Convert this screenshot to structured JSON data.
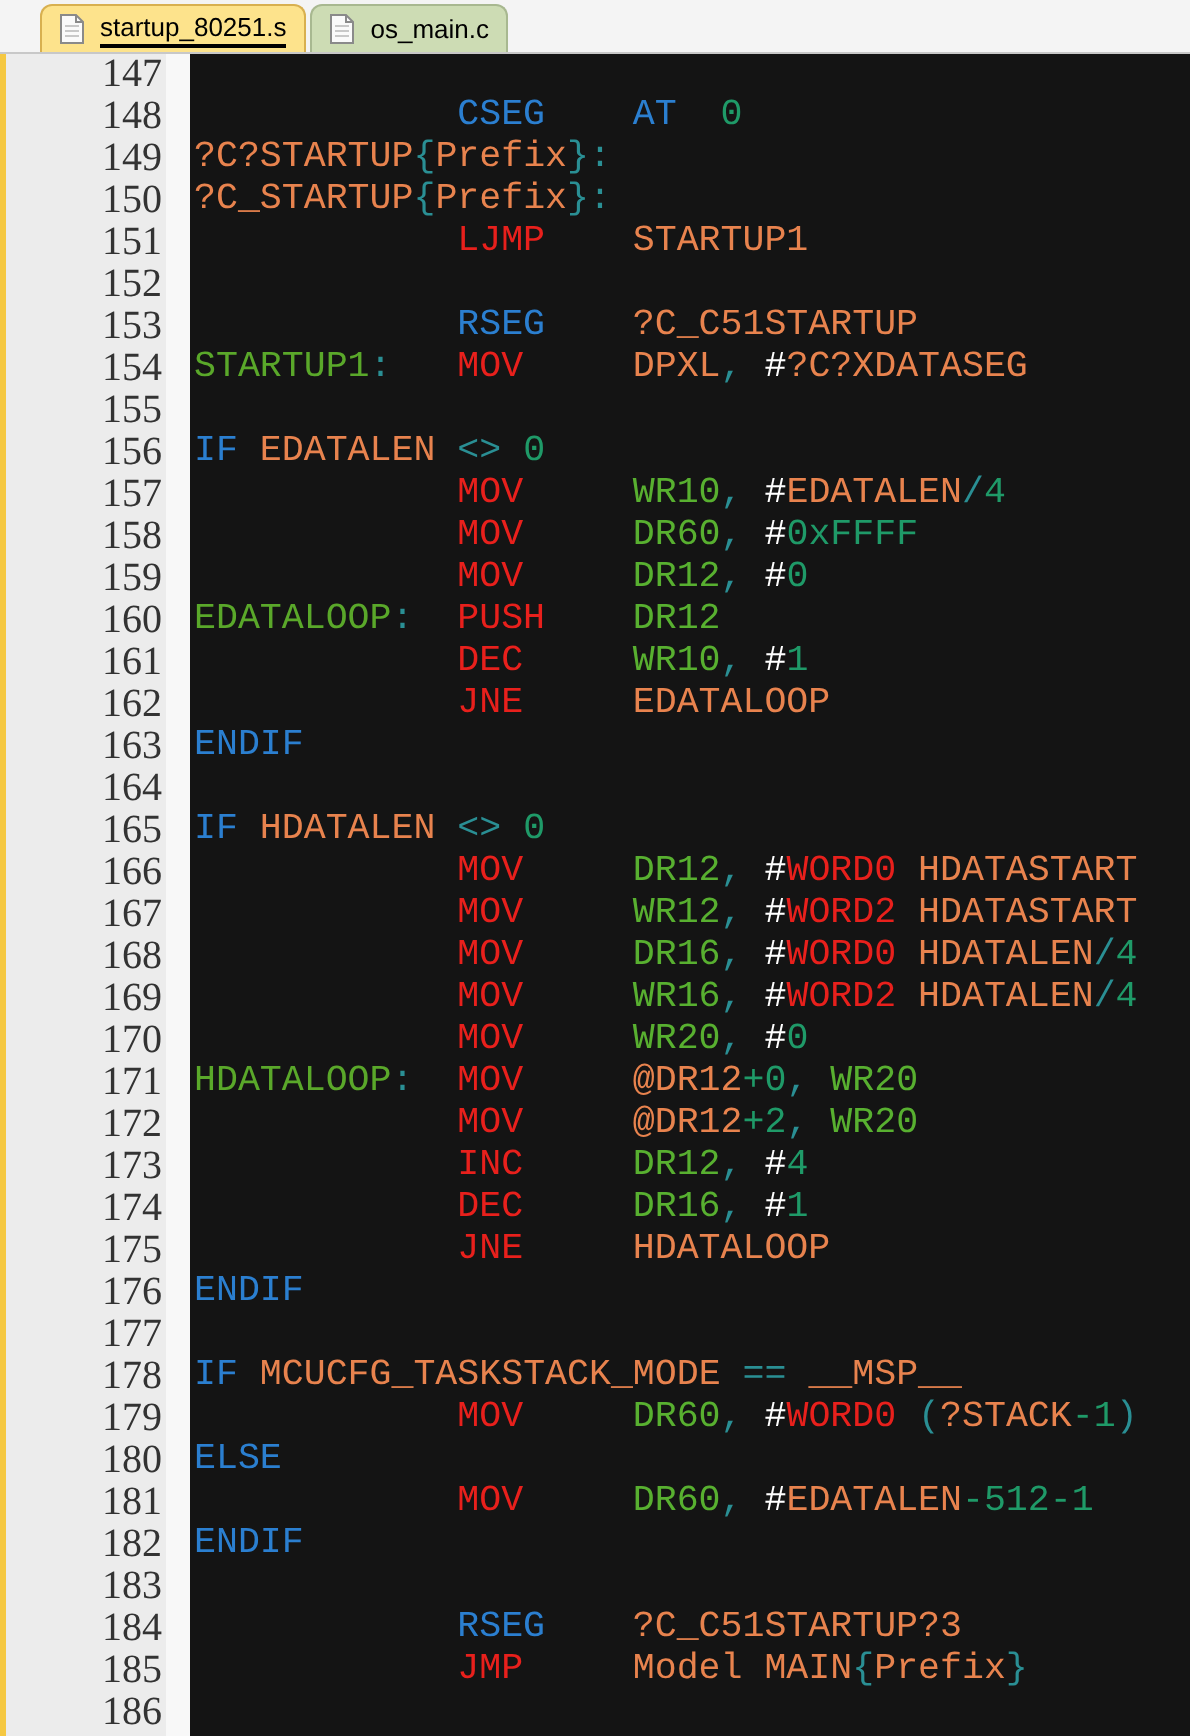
{
  "tabs": [
    {
      "label": "startup_80251.s",
      "selected": true
    },
    {
      "label": "os_main.c",
      "selected": false
    }
  ],
  "lines": [
    {
      "number": "147"
    },
    {
      "number": "148",
      "op": {
        "text": "CSEG",
        "kind": "kw"
      },
      "args": [
        {
          "text": "AT  ",
          "kind": "kw"
        },
        {
          "text": "0",
          "kind": "num"
        }
      ]
    },
    {
      "number": "149",
      "label": [
        {
          "text": "?C?STARTUP",
          "kind": "id"
        },
        {
          "text": "{",
          "kind": "p"
        },
        {
          "text": "Prefix",
          "kind": "id"
        },
        {
          "text": "}",
          "kind": "p"
        },
        {
          "text": ":",
          "kind": "p"
        }
      ]
    },
    {
      "number": "150",
      "label": [
        {
          "text": "?C_STARTUP",
          "kind": "id"
        },
        {
          "text": "{",
          "kind": "p"
        },
        {
          "text": "Prefix",
          "kind": "id"
        },
        {
          "text": "}",
          "kind": "p"
        },
        {
          "text": ":",
          "kind": "p"
        }
      ]
    },
    {
      "number": "151",
      "op": {
        "text": "LJMP",
        "kind": "mn"
      },
      "args": [
        {
          "text": "STARTUP1",
          "kind": "id"
        }
      ]
    },
    {
      "number": "152"
    },
    {
      "number": "153",
      "op": {
        "text": "RSEG",
        "kind": "kw"
      },
      "args": [
        {
          "text": "?C_C51STARTUP",
          "kind": "id"
        }
      ]
    },
    {
      "number": "154",
      "label": [
        {
          "text": "STARTUP1",
          "kind": "lbl"
        },
        {
          "text": ":",
          "kind": "p"
        }
      ],
      "op": {
        "text": "MOV",
        "kind": "mn"
      },
      "args": [
        {
          "text": "DPXL",
          "kind": "id"
        },
        {
          "text": ", ",
          "kind": "p"
        },
        {
          "text": "#",
          "kind": "hash"
        },
        {
          "text": "?C?XDATASEG",
          "kind": "id"
        }
      ]
    },
    {
      "number": "155"
    },
    {
      "number": "156",
      "label": [
        {
          "text": "IF ",
          "kind": "kw"
        },
        {
          "text": "EDATALEN ",
          "kind": "id"
        },
        {
          "text": "<> ",
          "kind": "p"
        },
        {
          "text": "0",
          "kind": "num"
        }
      ]
    },
    {
      "number": "157",
      "op": {
        "text": "MOV",
        "kind": "mn"
      },
      "args": [
        {
          "text": "WR10",
          "kind": "reg"
        },
        {
          "text": ", ",
          "kind": "p"
        },
        {
          "text": "#",
          "kind": "hash"
        },
        {
          "text": "EDATALEN",
          "kind": "id"
        },
        {
          "text": "/",
          "kind": "p"
        },
        {
          "text": "4",
          "kind": "num"
        }
      ]
    },
    {
      "number": "158",
      "op": {
        "text": "MOV",
        "kind": "mn"
      },
      "args": [
        {
          "text": "DR60",
          "kind": "reg"
        },
        {
          "text": ", ",
          "kind": "p"
        },
        {
          "text": "#",
          "kind": "hash"
        },
        {
          "text": "0xFFFF",
          "kind": "num"
        }
      ]
    },
    {
      "number": "159",
      "op": {
        "text": "MOV",
        "kind": "mn"
      },
      "args": [
        {
          "text": "DR12",
          "kind": "reg"
        },
        {
          "text": ", ",
          "kind": "p"
        },
        {
          "text": "#",
          "kind": "hash"
        },
        {
          "text": "0",
          "kind": "num"
        }
      ]
    },
    {
      "number": "160",
      "label": [
        {
          "text": "EDATALOOP",
          "kind": "lbl"
        },
        {
          "text": ":",
          "kind": "p"
        }
      ],
      "op": {
        "text": "PUSH",
        "kind": "mn"
      },
      "args": [
        {
          "text": "DR12",
          "kind": "reg"
        }
      ]
    },
    {
      "number": "161",
      "op": {
        "text": "DEC",
        "kind": "mn"
      },
      "args": [
        {
          "text": "WR10",
          "kind": "reg"
        },
        {
          "text": ", ",
          "kind": "p"
        },
        {
          "text": "#",
          "kind": "hash"
        },
        {
          "text": "1",
          "kind": "num"
        }
      ]
    },
    {
      "number": "162",
      "op": {
        "text": "JNE",
        "kind": "mn"
      },
      "args": [
        {
          "text": "EDATALOOP",
          "kind": "id"
        }
      ]
    },
    {
      "number": "163",
      "label": [
        {
          "text": "ENDIF",
          "kind": "kw"
        }
      ]
    },
    {
      "number": "164"
    },
    {
      "number": "165",
      "label": [
        {
          "text": "IF ",
          "kind": "kw"
        },
        {
          "text": "HDATALEN ",
          "kind": "id"
        },
        {
          "text": "<> ",
          "kind": "p"
        },
        {
          "text": "0",
          "kind": "num"
        }
      ]
    },
    {
      "number": "166",
      "op": {
        "text": "MOV",
        "kind": "mn"
      },
      "args": [
        {
          "text": "DR12",
          "kind": "reg"
        },
        {
          "text": ", ",
          "kind": "p"
        },
        {
          "text": "#",
          "kind": "hash"
        },
        {
          "text": "WORD0 ",
          "kind": "mn"
        },
        {
          "text": "HDATASTART",
          "kind": "id"
        }
      ]
    },
    {
      "number": "167",
      "op": {
        "text": "MOV",
        "kind": "mn"
      },
      "args": [
        {
          "text": "WR12",
          "kind": "reg"
        },
        {
          "text": ", ",
          "kind": "p"
        },
        {
          "text": "#",
          "kind": "hash"
        },
        {
          "text": "WORD2 ",
          "kind": "mn"
        },
        {
          "text": "HDATASTART",
          "kind": "id"
        }
      ]
    },
    {
      "number": "168",
      "op": {
        "text": "MOV",
        "kind": "mn"
      },
      "args": [
        {
          "text": "DR16",
          "kind": "reg"
        },
        {
          "text": ", ",
          "kind": "p"
        },
        {
          "text": "#",
          "kind": "hash"
        },
        {
          "text": "WORD0 ",
          "kind": "mn"
        },
        {
          "text": "HDATALEN",
          "kind": "id"
        },
        {
          "text": "/",
          "kind": "p"
        },
        {
          "text": "4",
          "kind": "num"
        }
      ]
    },
    {
      "number": "169",
      "op": {
        "text": "MOV",
        "kind": "mn"
      },
      "args": [
        {
          "text": "WR16",
          "kind": "reg"
        },
        {
          "text": ", ",
          "kind": "p"
        },
        {
          "text": "#",
          "kind": "hash"
        },
        {
          "text": "WORD2 ",
          "kind": "mn"
        },
        {
          "text": "HDATALEN",
          "kind": "id"
        },
        {
          "text": "/",
          "kind": "p"
        },
        {
          "text": "4",
          "kind": "num"
        }
      ]
    },
    {
      "number": "170",
      "op": {
        "text": "MOV",
        "kind": "mn"
      },
      "args": [
        {
          "text": "WR20",
          "kind": "reg"
        },
        {
          "text": ", ",
          "kind": "p"
        },
        {
          "text": "#",
          "kind": "hash"
        },
        {
          "text": "0",
          "kind": "num"
        }
      ]
    },
    {
      "number": "171",
      "label": [
        {
          "text": "HDATALOOP",
          "kind": "lbl"
        },
        {
          "text": ":",
          "kind": "p"
        }
      ],
      "op": {
        "text": "MOV",
        "kind": "mn"
      },
      "args": [
        {
          "text": "@DR12",
          "kind": "id"
        },
        {
          "text": "+0",
          "kind": "num"
        },
        {
          "text": ", ",
          "kind": "p"
        },
        {
          "text": "WR20",
          "kind": "reg"
        }
      ]
    },
    {
      "number": "172",
      "op": {
        "text": "MOV",
        "kind": "mn"
      },
      "args": [
        {
          "text": "@DR12",
          "kind": "id"
        },
        {
          "text": "+2",
          "kind": "num"
        },
        {
          "text": ", ",
          "kind": "p"
        },
        {
          "text": "WR20",
          "kind": "reg"
        }
      ]
    },
    {
      "number": "173",
      "op": {
        "text": "INC",
        "kind": "mn"
      },
      "args": [
        {
          "text": "DR12",
          "kind": "reg"
        },
        {
          "text": ", ",
          "kind": "p"
        },
        {
          "text": "#",
          "kind": "hash"
        },
        {
          "text": "4",
          "kind": "num"
        }
      ]
    },
    {
      "number": "174",
      "op": {
        "text": "DEC",
        "kind": "mn"
      },
      "args": [
        {
          "text": "DR16",
          "kind": "reg"
        },
        {
          "text": ", ",
          "kind": "p"
        },
        {
          "text": "#",
          "kind": "hash"
        },
        {
          "text": "1",
          "kind": "num"
        }
      ]
    },
    {
      "number": "175",
      "op": {
        "text": "JNE",
        "kind": "mn"
      },
      "args": [
        {
          "text": "HDATALOOP",
          "kind": "id"
        }
      ]
    },
    {
      "number": "176",
      "label": [
        {
          "text": "ENDIF",
          "kind": "kw"
        }
      ]
    },
    {
      "number": "177"
    },
    {
      "number": "178",
      "label": [
        {
          "text": "IF ",
          "kind": "kw"
        },
        {
          "text": "MCUCFG_TASKSTACK_MODE ",
          "kind": "id"
        },
        {
          "text": "== ",
          "kind": "p"
        },
        {
          "text": "__MSP__",
          "kind": "id"
        }
      ]
    },
    {
      "number": "179",
      "op": {
        "text": "MOV",
        "kind": "mn"
      },
      "args": [
        {
          "text": "DR60",
          "kind": "reg"
        },
        {
          "text": ", ",
          "kind": "p"
        },
        {
          "text": "#",
          "kind": "hash"
        },
        {
          "text": "WORD0 ",
          "kind": "mn"
        },
        {
          "text": "(",
          "kind": "p"
        },
        {
          "text": "?STACK",
          "kind": "id"
        },
        {
          "text": "-1",
          "kind": "num"
        },
        {
          "text": ")",
          "kind": "p"
        }
      ]
    },
    {
      "number": "180",
      "label": [
        {
          "text": "ELSE",
          "kind": "kw"
        }
      ]
    },
    {
      "number": "181",
      "op": {
        "text": "MOV",
        "kind": "mn"
      },
      "args": [
        {
          "text": "DR60",
          "kind": "reg"
        },
        {
          "text": ", ",
          "kind": "p"
        },
        {
          "text": "#",
          "kind": "hash"
        },
        {
          "text": "EDATALEN",
          "kind": "id"
        },
        {
          "text": "-512-1",
          "kind": "num"
        }
      ]
    },
    {
      "number": "182",
      "label": [
        {
          "text": "ENDIF",
          "kind": "kw"
        }
      ]
    },
    {
      "number": "183"
    },
    {
      "number": "184",
      "op": {
        "text": "RSEG",
        "kind": "kw"
      },
      "args": [
        {
          "text": "?C_C51STARTUP?3",
          "kind": "id"
        }
      ]
    },
    {
      "number": "185",
      "op": {
        "text": "JMP",
        "kind": "mn"
      },
      "args": [
        {
          "text": "Model MAIN",
          "kind": "id"
        },
        {
          "text": "{",
          "kind": "p"
        },
        {
          "text": "Prefix",
          "kind": "id"
        },
        {
          "text": "}",
          "kind": "p"
        }
      ]
    },
    {
      "number": "186"
    }
  ]
}
